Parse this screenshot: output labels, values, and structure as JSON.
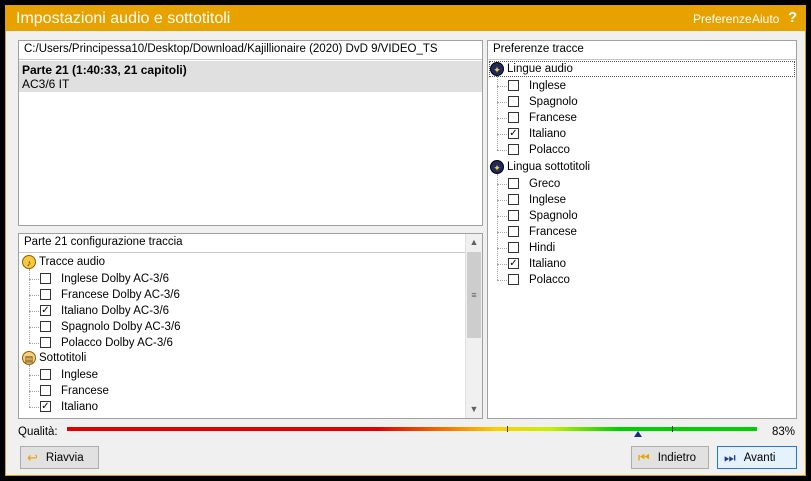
{
  "window": {
    "title": "Impostazioni audio e sottotitoli",
    "menu": {
      "preferences": "Preferenze",
      "help": "Aiuto",
      "help_icon": "?"
    }
  },
  "title_panel": {
    "path": "C:/Users/Principessa10/Desktop/Download/Kajillionaire (2020) DvD 9/VIDEO_TS",
    "selected_title": "Parte 21 (1:40:33, 21 capitoli)",
    "selected_codec": "AC3/6 IT"
  },
  "config_panel": {
    "header": "Parte 21 configurazione traccia",
    "audio_group": "Tracce audio",
    "audio_tracks": [
      {
        "label": "Inglese Dolby AC-3/6",
        "checked": false
      },
      {
        "label": "Francese Dolby AC-3/6",
        "checked": false
      },
      {
        "label": "Italiano Dolby AC-3/6",
        "checked": true
      },
      {
        "label": "Spagnolo Dolby AC-3/6",
        "checked": false
      },
      {
        "label": "Polacco Dolby AC-3/6",
        "checked": false
      }
    ],
    "subtitle_group": "Sottotitoli",
    "subtitle_tracks": [
      {
        "label": "Inglese",
        "checked": false
      },
      {
        "label": "Francese",
        "checked": false
      },
      {
        "label": "Italiano",
        "checked": true
      }
    ]
  },
  "pref_panel": {
    "header": "Preferenze tracce",
    "audio_group": "Lingue audio",
    "audio_langs": [
      {
        "label": "Inglese",
        "checked": false
      },
      {
        "label": "Spagnolo",
        "checked": false
      },
      {
        "label": "Francese",
        "checked": false
      },
      {
        "label": "Italiano",
        "checked": true
      },
      {
        "label": "Polacco",
        "checked": false
      }
    ],
    "subtitle_group": "Lingua sottotitoli",
    "subtitle_langs": [
      {
        "label": "Greco",
        "checked": false
      },
      {
        "label": "Inglese",
        "checked": false
      },
      {
        "label": "Spagnolo",
        "checked": false
      },
      {
        "label": "Francese",
        "checked": false
      },
      {
        "label": "Hindi",
        "checked": false
      },
      {
        "label": "Italiano",
        "checked": true
      },
      {
        "label": "Polacco",
        "checked": false
      }
    ]
  },
  "quality": {
    "label": "Qualità:",
    "value": "83%"
  },
  "buttons": {
    "restart": "Riavvia",
    "back": "Indietro",
    "next": "Avanti"
  },
  "colors": {
    "titlebar": "#e8a200",
    "selection": "#e0e0e0"
  }
}
